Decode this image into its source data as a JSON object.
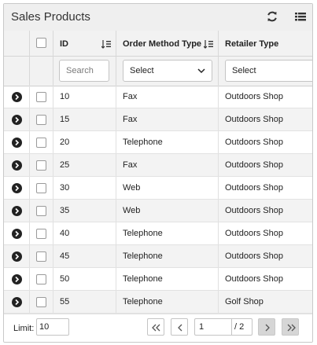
{
  "panel": {
    "title": "Sales Products",
    "refresh_icon": "refresh-icon",
    "columns_icon": "list-icon"
  },
  "columns": {
    "id": "ID",
    "order_method": "Order Method Type",
    "retailer_type": "Retailer Type",
    "sort_icon": "sort-icon"
  },
  "filters": {
    "id_placeholder": "Search",
    "order_method_value": "Select",
    "retailer_value": "Select"
  },
  "rows": [
    {
      "id": "10",
      "order_method": "Fax",
      "retailer_type": "Outdoors Shop"
    },
    {
      "id": "15",
      "order_method": "Fax",
      "retailer_type": "Outdoors Shop"
    },
    {
      "id": "20",
      "order_method": "Telephone",
      "retailer_type": "Outdoors Shop"
    },
    {
      "id": "25",
      "order_method": "Fax",
      "retailer_type": "Outdoors Shop"
    },
    {
      "id": "30",
      "order_method": "Web",
      "retailer_type": "Outdoors Shop"
    },
    {
      "id": "35",
      "order_method": "Web",
      "retailer_type": "Outdoors Shop"
    },
    {
      "id": "40",
      "order_method": "Telephone",
      "retailer_type": "Outdoors Shop"
    },
    {
      "id": "45",
      "order_method": "Telephone",
      "retailer_type": "Outdoors Shop"
    },
    {
      "id": "50",
      "order_method": "Telephone",
      "retailer_type": "Outdoors Shop"
    },
    {
      "id": "55",
      "order_method": "Telephone",
      "retailer_type": "Golf Shop"
    }
  ],
  "footer": {
    "limit_label": "Limit:",
    "limit_value": "10",
    "current_page": "1",
    "total_pages": "/ 2"
  }
}
